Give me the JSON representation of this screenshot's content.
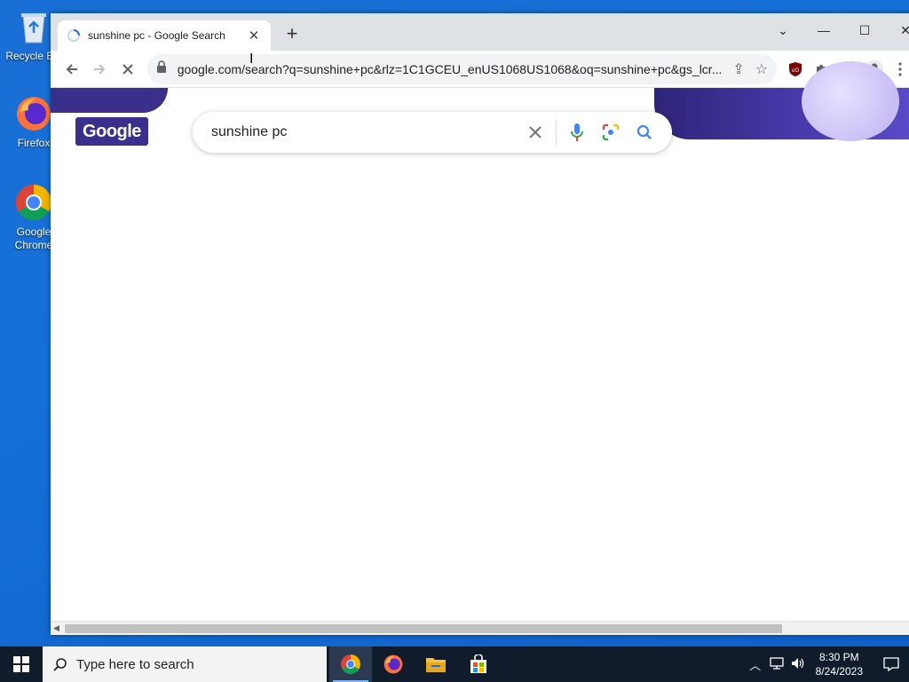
{
  "desktop": {
    "icons": [
      {
        "label": "Recycle Bin"
      },
      {
        "label": "Firefox"
      },
      {
        "label": "Google Chrome"
      }
    ]
  },
  "browser": {
    "tab": {
      "title": "sunshine pc - Google Search"
    },
    "toolbar": {
      "url": "google.com/search?q=sunshine+pc&rlz=1C1GCEU_enUS1068US1068&oq=sunshine+pc&gs_lcr..."
    }
  },
  "page": {
    "logo_text": "Google",
    "search": {
      "query": "sunshine pc"
    }
  },
  "taskbar": {
    "search_placeholder": "Type here to search",
    "clock": {
      "time": "8:30 PM",
      "date": "8/24/2023"
    }
  },
  "colors": {
    "desktop_bg": "#1570d8",
    "doodle_purple": "#3b2f8c",
    "google_blue": "#4285f4"
  }
}
